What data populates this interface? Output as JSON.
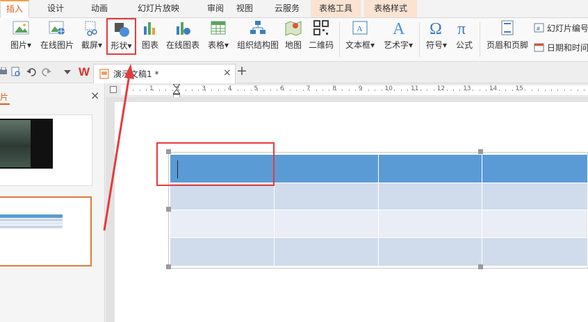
{
  "menu_tabs": [
    {
      "label": "插入",
      "active": true
    },
    {
      "label": "设计"
    },
    {
      "label": "动画"
    },
    {
      "label": "幻灯片放映"
    },
    {
      "label": "审阅"
    },
    {
      "label": "视图"
    },
    {
      "label": "云服务"
    },
    {
      "label": "表格工具",
      "contextual": true
    },
    {
      "label": "表格样式",
      "contextual": true
    }
  ],
  "ribbon": {
    "picture": "图片",
    "online_picture": "在线图片",
    "screenshot": "截屏",
    "shape": "形状",
    "chart": "图表",
    "online_chart": "在线图表",
    "table": "表格",
    "org_chart": "组织结构图",
    "map": "地图",
    "qrcode": "二维码",
    "textbox": "文本框",
    "wordart": "艺术字",
    "symbol": "符号",
    "formula": "公式",
    "header_footer": "页眉和页脚",
    "slide_number": "幻灯片编号",
    "date_time": "日期和时间",
    "dropdown_glyph": "▾"
  },
  "doc_tab": {
    "title": "演示文稿1 *",
    "close": "×",
    "new": "+",
    "wps_logo": "W"
  },
  "left_panel": {
    "title": "片",
    "close": "×"
  },
  "ruler": {
    "labels": [
      "1",
      "2",
      "3",
      "4",
      "5",
      "6",
      "7",
      "8",
      "9",
      "10",
      "11",
      "12",
      "13",
      "14",
      "15"
    ]
  },
  "colors": {
    "accent": "#e05b1a",
    "highlight": "#e8393b",
    "table_header": "#5b9bd5",
    "table_row_a": "#d0dcec",
    "table_row_b": "#e8edf6"
  }
}
